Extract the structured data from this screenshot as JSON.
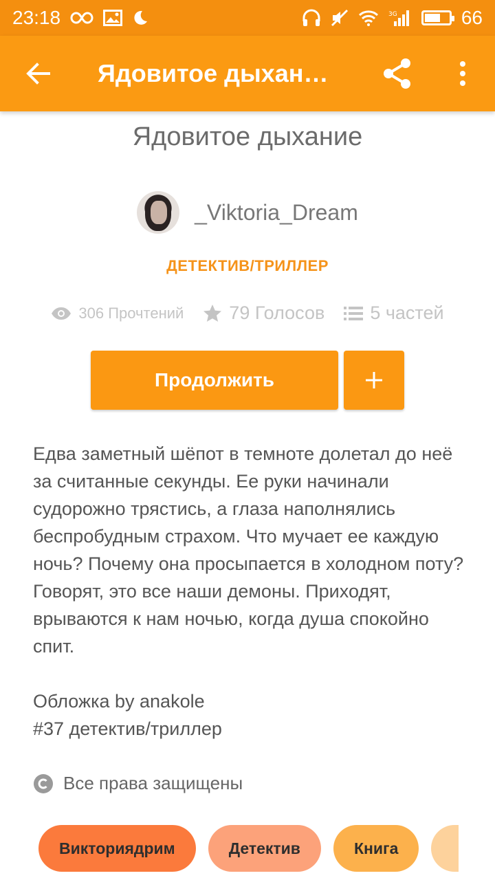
{
  "status_bar": {
    "time": "23:18",
    "battery": "66",
    "battery_level": 0.66
  },
  "app_bar": {
    "title": "Ядовитое дыхан…",
    "back_icon": "arrow-left-icon",
    "share_icon": "share-icon",
    "more_icon": "more-vertical-icon"
  },
  "story": {
    "title": "Ядовитое дыхание",
    "author": "_Viktoria_Dream",
    "genre": "ДЕТЕКТИВ/ТРИЛЛЕР",
    "stats": {
      "reads": "306 Прочтений",
      "votes": "79 Голосов",
      "parts": "5 частей"
    },
    "continue_label": "Продолжить",
    "add_label": "+",
    "description": [
      "Едва заметный шёпот в темноте долетал до неё за считанные секунды. Ее руки начинали судорожно трястись, а глаза наполнялись беспробудным страхом. Что мучает ее каждую ночь? Почему она просыпается в холодном поту? Говорят, это все наши демоны. Приходят, врываются к нам ночью, когда душа спокойно спит.",
      "Обложка by anakole\n#37 детектив/триллер"
    ],
    "copyright": "Все права защищены",
    "tags": [
      {
        "label": "Викториядрим",
        "color": "#fb7a3c"
      },
      {
        "label": "Детектив",
        "color": "#fca27a"
      },
      {
        "label": "Книга",
        "color": "#fcb14c"
      }
    ]
  },
  "colors": {
    "status_bar": "#f48f0f",
    "app_bar": "#fb9a12",
    "accent": "#fb9812",
    "genre": "#f5931a"
  }
}
